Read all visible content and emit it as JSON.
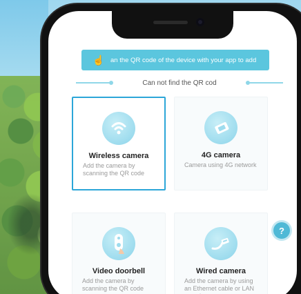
{
  "banner": {
    "text": "an the QR code of the device with your app to add",
    "icon": "hand-pointer-icon"
  },
  "divider": {
    "text": "Can not find the QR cod"
  },
  "cards": [
    {
      "title": "Wireless camera",
      "description": "Add the camera by scanning the QR code",
      "icon": "wifi-camera-icon",
      "selected": true
    },
    {
      "title": "4G camera",
      "description": "Camera using 4G network",
      "icon": "sim-card-icon",
      "selected": false
    },
    {
      "title": "Video doorbell",
      "description": "Add the camera by scanning the QR code",
      "icon": "doorbell-icon",
      "selected": false
    },
    {
      "title": "Wired camera",
      "description": "Add the camera by using an Ethernet cable  or LAN search",
      "icon": "ethernet-cable-icon",
      "selected": false
    }
  ],
  "help": {
    "icon": "help-bubble-icon"
  },
  "colors": {
    "accent": "#2ba6d8",
    "banner": "#5bc6de",
    "icon_bg": "#9edcee"
  }
}
